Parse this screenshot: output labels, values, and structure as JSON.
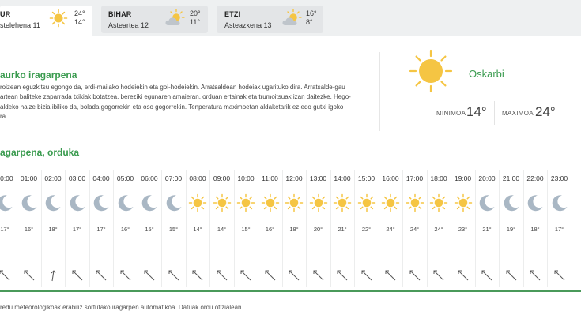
{
  "tabs": [
    {
      "name": "UR",
      "date": "stelehena 11",
      "max": "24°",
      "min": "14°",
      "icon": "sun-icon",
      "active": true
    },
    {
      "name": "BIHAR",
      "date": "Asteartea 12",
      "max": "20°",
      "min": "11°",
      "icon": "sun-cloud-icon",
      "active": false
    },
    {
      "name": "ETZI",
      "date": "Asteazkena 13",
      "max": "16°",
      "min": "8°",
      "icon": "sun-cloud-icon",
      "active": false
    }
  ],
  "forecast": {
    "title": "aurko iragarpena",
    "lines": [
      "roizean eguzkitsu egongo da, erdi-mailako hodeiekin eta goi-hodeiekin. Arratsaldean hodeiak ugarituko dira. Arratsalde-gau",
      "artean baliteke zaparrada txikiak botatzea, bereziki egunaren amaieran, orduan ertainak eta trumoitsuak izan daitezke. Hego-",
      "aldeko haize bizia ibiliko da, bolada gogorrekin eta oso gogorrekin. Tenperatura maximoetan aldaketarik ez edo gutxi igoko",
      "ra."
    ]
  },
  "today": {
    "condition": "Oskarbi",
    "min_label": "MINIMOA",
    "min_value": "14°",
    "max_label": "MAXIMOA",
    "max_value": "24°",
    "icon": "sun-icon"
  },
  "hourly": {
    "title": "agarpena, orduka",
    "items": [
      {
        "time": "00:00",
        "icon": "moon-icon",
        "temp": "17°",
        "wind_dir": "nw"
      },
      {
        "time": "01:00",
        "icon": "moon-icon",
        "temp": "16°",
        "wind_dir": "nw"
      },
      {
        "time": "02:00",
        "icon": "moon-icon",
        "temp": "18°",
        "wind_dir": "n"
      },
      {
        "time": "03:00",
        "icon": "moon-icon",
        "temp": "17°",
        "wind_dir": "nw"
      },
      {
        "time": "04:00",
        "icon": "moon-icon",
        "temp": "17°",
        "wind_dir": "nw"
      },
      {
        "time": "05:00",
        "icon": "moon-icon",
        "temp": "16°",
        "wind_dir": "nw"
      },
      {
        "time": "06:00",
        "icon": "moon-icon",
        "temp": "15°",
        "wind_dir": "nw"
      },
      {
        "time": "07:00",
        "icon": "moon-icon",
        "temp": "15°",
        "wind_dir": "nw"
      },
      {
        "time": "08:00",
        "icon": "sun-icon",
        "temp": "14°",
        "wind_dir": "nw"
      },
      {
        "time": "09:00",
        "icon": "sun-icon",
        "temp": "14°",
        "wind_dir": "nw"
      },
      {
        "time": "10:00",
        "icon": "sun-icon",
        "temp": "15°",
        "wind_dir": "nw"
      },
      {
        "time": "11:00",
        "icon": "sun-icon",
        "temp": "16°",
        "wind_dir": "nw"
      },
      {
        "time": "12:00",
        "icon": "sun-icon",
        "temp": "18°",
        "wind_dir": "nw"
      },
      {
        "time": "13:00",
        "icon": "sun-icon",
        "temp": "20°",
        "wind_dir": "nw"
      },
      {
        "time": "14:00",
        "icon": "sun-icon",
        "temp": "21°",
        "wind_dir": "nw"
      },
      {
        "time": "15:00",
        "icon": "sun-icon",
        "temp": "22°",
        "wind_dir": "nw"
      },
      {
        "time": "16:00",
        "icon": "sun-icon",
        "temp": "24°",
        "wind_dir": "nw"
      },
      {
        "time": "17:00",
        "icon": "sun-icon",
        "temp": "24°",
        "wind_dir": "nw"
      },
      {
        "time": "18:00",
        "icon": "sun-icon",
        "temp": "24°",
        "wind_dir": "nw"
      },
      {
        "time": "19:00",
        "icon": "sun-icon",
        "temp": "23°",
        "wind_dir": "nw"
      },
      {
        "time": "20:00",
        "icon": "moon-icon",
        "temp": "21°",
        "wind_dir": "nw"
      },
      {
        "time": "21:00",
        "icon": "moon-icon",
        "temp": "19°",
        "wind_dir": "nw"
      },
      {
        "time": "22:00",
        "icon": "moon-icon",
        "temp": "18°",
        "wind_dir": "nw"
      },
      {
        "time": "23:00",
        "icon": "moon-icon",
        "temp": "17°",
        "wind_dir": "nw"
      }
    ]
  },
  "footnote": "redu meteorologikoak erabiliz sortutako iragarpen automatikoa. Datuak ordu ofizialean",
  "colors": {
    "accent": "#3a9b4f",
    "sun": "#f5c543",
    "moon": "#a9b7c4",
    "cloud": "#bfc5cb"
  }
}
